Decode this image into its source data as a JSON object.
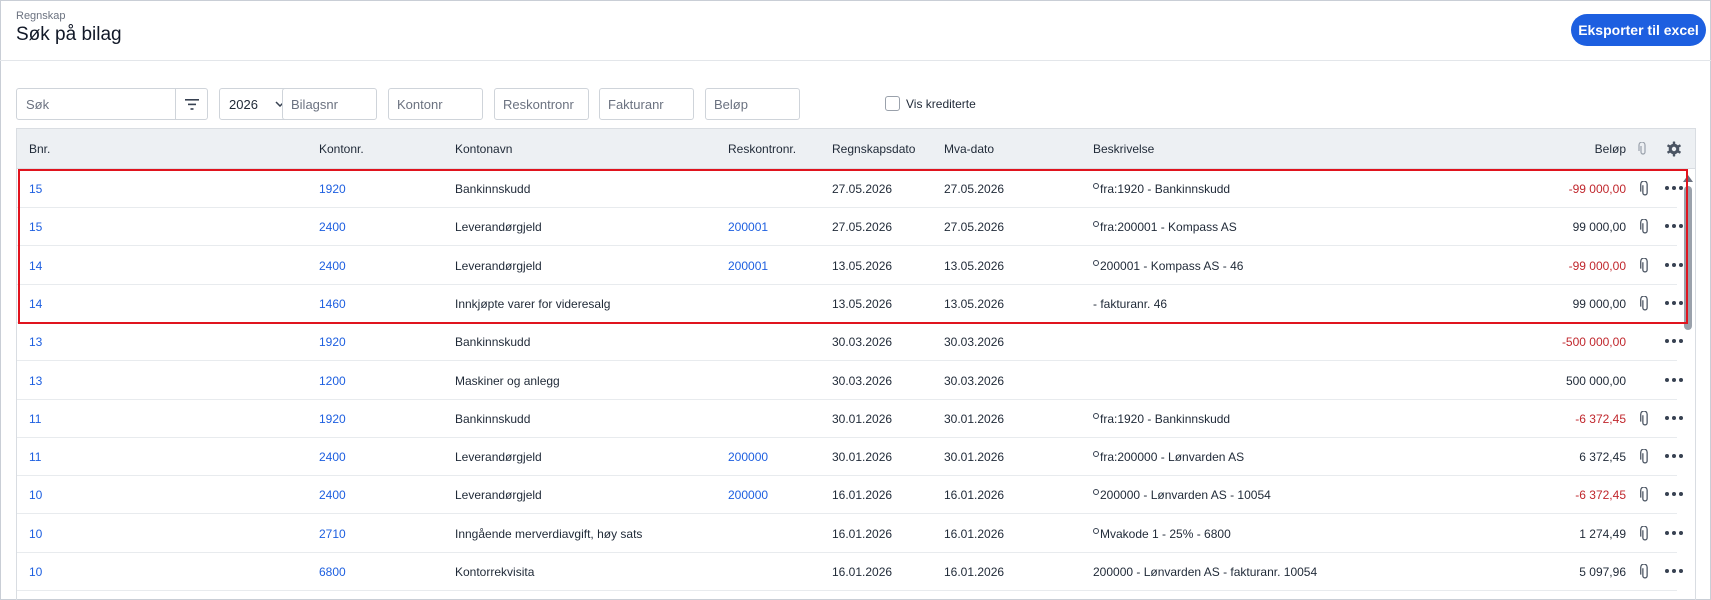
{
  "header": {
    "breadcrumb": "Regnskap",
    "title": "Søk på bilag",
    "export_label": "Eksporter til excel"
  },
  "filters": {
    "search_placeholder": "Søk",
    "year": "2026",
    "bilagsnr_placeholder": "Bilagsnr",
    "kontonr_placeholder": "Kontonr",
    "reskontronr_placeholder": "Reskontronr",
    "fakturanr_placeholder": "Fakturanr",
    "belop_placeholder": "Beløp",
    "vis_krediterte_label": "Vis krediterte",
    "vis_krediterte_checked": false
  },
  "table": {
    "columns": {
      "bnr": "Bnr.",
      "kontonr": "Kontonr.",
      "kontonavn": "Kontonavn",
      "reskontronr": "Reskontronr.",
      "regnskapsdato": "Regnskapsdato",
      "mvadato": "Mva-dato",
      "beskrivelse": "Beskrivelse",
      "belop": "Beløp"
    },
    "rows": [
      {
        "bnr": "15",
        "kontonr": "1920",
        "kontonavn": "Bankinnskudd",
        "reskontronr": "",
        "regnskapsdato": "27.05.2026",
        "mvadato": "27.05.2026",
        "beskrivelse_icon": true,
        "beskrivelse": "fra:1920 - Bankinnskudd",
        "belop": "-99 000,00",
        "negative": true,
        "attachment": true
      },
      {
        "bnr": "15",
        "kontonr": "2400",
        "kontonavn": "Leverandørgjeld",
        "reskontronr": "200001",
        "regnskapsdato": "27.05.2026",
        "mvadato": "27.05.2026",
        "beskrivelse_icon": true,
        "beskrivelse": "fra:200001 - Kompass AS",
        "belop": "99 000,00",
        "negative": false,
        "attachment": true
      },
      {
        "bnr": "14",
        "kontonr": "2400",
        "kontonavn": "Leverandørgjeld",
        "reskontronr": "200001",
        "regnskapsdato": "13.05.2026",
        "mvadato": "13.05.2026",
        "beskrivelse_icon": true,
        "beskrivelse": "200001 - Kompass AS - 46",
        "belop": "-99 000,00",
        "negative": true,
        "attachment": true
      },
      {
        "bnr": "14",
        "kontonr": "1460",
        "kontonavn": "Innkjøpte varer for videresalg",
        "reskontronr": "",
        "regnskapsdato": "13.05.2026",
        "mvadato": "13.05.2026",
        "beskrivelse_icon": false,
        "beskrivelse": "- fakturanr. 46",
        "belop": "99 000,00",
        "negative": false,
        "attachment": true
      },
      {
        "bnr": "13",
        "kontonr": "1920",
        "kontonavn": "Bankinnskudd",
        "reskontronr": "",
        "regnskapsdato": "30.03.2026",
        "mvadato": "30.03.2026",
        "beskrivelse_icon": false,
        "beskrivelse": "",
        "belop": "-500 000,00",
        "negative": true,
        "attachment": false
      },
      {
        "bnr": "13",
        "kontonr": "1200",
        "kontonavn": "Maskiner og anlegg",
        "reskontronr": "",
        "regnskapsdato": "30.03.2026",
        "mvadato": "30.03.2026",
        "beskrivelse_icon": false,
        "beskrivelse": "",
        "belop": "500 000,00",
        "negative": false,
        "attachment": false
      },
      {
        "bnr": "11",
        "kontonr": "1920",
        "kontonavn": "Bankinnskudd",
        "reskontronr": "",
        "regnskapsdato": "30.01.2026",
        "mvadato": "30.01.2026",
        "beskrivelse_icon": true,
        "beskrivelse": "fra:1920 - Bankinnskudd",
        "belop": "-6 372,45",
        "negative": true,
        "attachment": true
      },
      {
        "bnr": "11",
        "kontonr": "2400",
        "kontonavn": "Leverandørgjeld",
        "reskontronr": "200000",
        "regnskapsdato": "30.01.2026",
        "mvadato": "30.01.2026",
        "beskrivelse_icon": true,
        "beskrivelse": "fra:200000 - Lønvarden AS",
        "belop": "6 372,45",
        "negative": false,
        "attachment": true
      },
      {
        "bnr": "10",
        "kontonr": "2400",
        "kontonavn": "Leverandørgjeld",
        "reskontronr": "200000",
        "regnskapsdato": "16.01.2026",
        "mvadato": "16.01.2026",
        "beskrivelse_icon": true,
        "beskrivelse": "200000 - Lønvarden AS - 10054",
        "belop": "-6 372,45",
        "negative": true,
        "attachment": true
      },
      {
        "bnr": "10",
        "kontonr": "2710",
        "kontonavn": "Inngående merverdiavgift, høy sats",
        "reskontronr": "",
        "regnskapsdato": "16.01.2026",
        "mvadato": "16.01.2026",
        "beskrivelse_icon": true,
        "beskrivelse": "Mvakode 1 - 25% - 6800",
        "belop": "1 274,49",
        "negative": false,
        "attachment": true
      },
      {
        "bnr": "10",
        "kontonr": "6800",
        "kontonavn": "Kontorrekvisita",
        "reskontronr": "",
        "regnskapsdato": "16.01.2026",
        "mvadato": "16.01.2026",
        "beskrivelse_icon": false,
        "beskrivelse": "200000 - Lønvarden AS - fakturanr. 10054",
        "belop": "5 097,96",
        "negative": false,
        "attachment": true
      }
    ]
  },
  "colors": {
    "accent": "#1d5fe0",
    "negative": "#c0272d",
    "highlight": "#e0141e"
  }
}
